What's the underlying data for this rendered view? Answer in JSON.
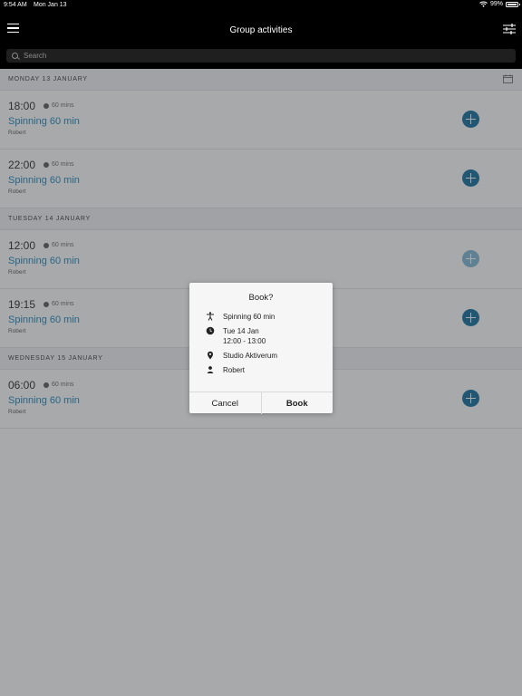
{
  "status": {
    "time": "9:54 AM",
    "date": "Mon Jan 13",
    "battery": "99%"
  },
  "nav": {
    "title": "Group activities"
  },
  "search": {
    "placeholder": "Search"
  },
  "days": [
    {
      "label": "MONDAY 13 JANUARY",
      "sessions": [
        {
          "time": "18:00",
          "duration": "60 mins",
          "name": "Spinning 60 min",
          "instructor": "Robert"
        },
        {
          "time": "22:00",
          "duration": "60 mins",
          "name": "Spinning 60 min",
          "instructor": "Robert"
        }
      ]
    },
    {
      "label": "TUESDAY 14 JANUARY",
      "sessions": [
        {
          "time": "12:00",
          "duration": "60 mins",
          "name": "Spinning 60 min",
          "instructor": "Robert"
        },
        {
          "time": "19:15",
          "duration": "60 mins",
          "name": "Spinning 60 min",
          "instructor": "Robert"
        }
      ]
    },
    {
      "label": "WEDNESDAY 15 JANUARY",
      "sessions": [
        {
          "time": "06:00",
          "duration": "60 mins",
          "name": "Spinning 60 min",
          "instructor": "Robert"
        }
      ]
    }
  ],
  "dialog": {
    "title": "Book?",
    "activity": "Spinning 60 min",
    "date": "Tue 14 Jan",
    "time_range": "12:00 - 13:00",
    "location": "Studio Aktiverum",
    "instructor": "Robert",
    "cancel_label": "Cancel",
    "book_label": "Book"
  },
  "colors": {
    "accent": "#1d83b8",
    "add_button": "#0d6a9c",
    "add_button_disabled": "#7fb5d3"
  }
}
